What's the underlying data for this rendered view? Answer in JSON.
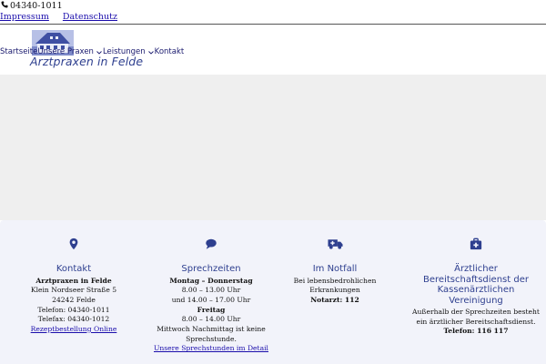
{
  "topbar": {
    "phone_icon": "phone-icon",
    "phone": "04340-1011",
    "links": [
      "Impressum",
      "Datenschutz"
    ]
  },
  "header": {
    "logo_alt": "house-logo",
    "logo_text": "Arztpraxen in Felde",
    "nav": {
      "startseite": "Startseite",
      "praxen": "Unsere Praxen",
      "leistungen": "Leistungen",
      "kontakt": "Kontakt"
    }
  },
  "info": {
    "kontakt": {
      "icon": "map-marker-icon",
      "title": "Kontakt",
      "name": "Arztpraxen in Felde",
      "street": "Klein Nordseer Straße 5",
      "city": "24242 Felde",
      "phone": "Telefon: 04340-1011",
      "fax": "Telefax: 04340-1012",
      "link": "Rezeptbestellung Online"
    },
    "sprechzeiten": {
      "icon": "chat-bubble-icon",
      "title": "Sprechzeiten",
      "day1": "Montag – Donnerstag",
      "time1": "8.00 – 13.00 Uhr",
      "time2": "und 14.00 – 17.00 Uhr",
      "day2": "Freitag",
      "time3": "8.00 – 14.00 Uhr",
      "note1": "Mittwoch Nachmittag ist keine",
      "note2": "Sprechstunde.",
      "link": "Unsere Sprechstunden im Detail"
    },
    "notfall": {
      "icon": "ambulance-icon",
      "title": "Im Notfall",
      "line1": "Bei lebensbedrohlichen",
      "line2": "Erkrankungen",
      "notarzt": "Notarzt: 112"
    },
    "bereitschaft": {
      "icon": "medical-kit-icon",
      "title_lines": [
        "Ärztlicher",
        "Bereitschaftsdienst der",
        "Kassenärztlichen",
        "Vereinigung"
      ],
      "line1": "Außerhalb der Sprechzeiten besteht",
      "line2": "ein ärztlicher Bereitschaftsdienst.",
      "phone": "Telefon: 116 117"
    }
  },
  "colors": {
    "accent": "#2e3f8f",
    "link": "#1a0dab",
    "info_bg": "#f2f3fa",
    "hero_bg": "#efefef"
  }
}
